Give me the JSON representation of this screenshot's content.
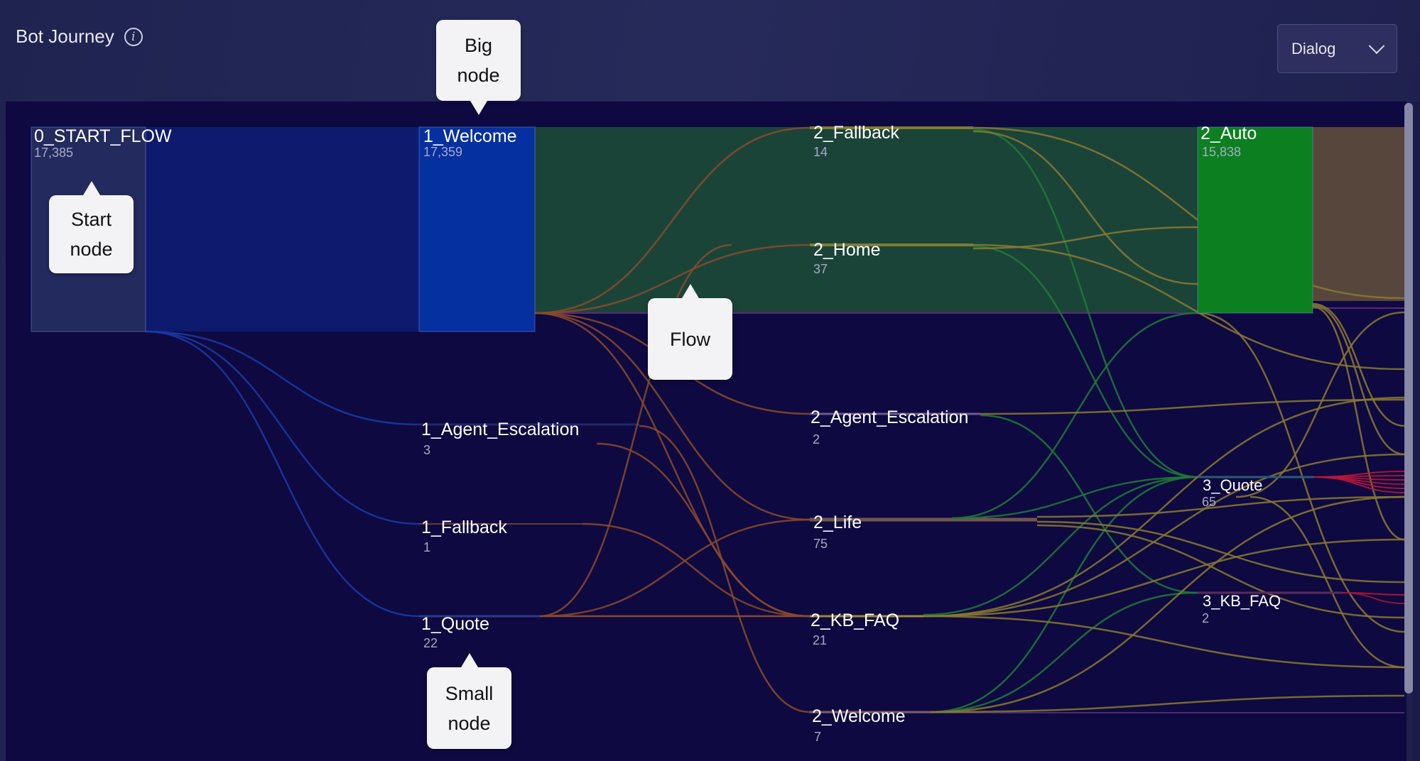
{
  "header": {
    "title": "Bot Journey",
    "info_icon": "info-circle-icon",
    "view_select": {
      "selected": "Dialog",
      "icon": "chevron-down-icon"
    }
  },
  "chart_data": {
    "type": "sankey",
    "title": "Bot Journey",
    "nodes": [
      {
        "id": "0_START_FLOW",
        "label": "0_START_FLOW",
        "count": "17,385",
        "value": 17385,
        "step": 0,
        "color": "#232a5e"
      },
      {
        "id": "1_Welcome",
        "label": "1_Welcome",
        "count": "17,359",
        "value": 17359,
        "step": 1,
        "color": "#0530a0"
      },
      {
        "id": "1_Agent_Escalation",
        "label": "1_Agent_Escalation",
        "count": "3",
        "value": 3,
        "step": 1,
        "color": "#1b2a80"
      },
      {
        "id": "1_Fallback",
        "label": "1_Fallback",
        "count": "1",
        "value": 1,
        "step": 1,
        "color": "#1b2a80"
      },
      {
        "id": "1_Quote",
        "label": "1_Quote",
        "count": "22",
        "value": 22,
        "step": 1,
        "color": "#1b2a80"
      },
      {
        "id": "2_Fallback",
        "label": "2_Fallback",
        "count": "14",
        "value": 14,
        "step": 2,
        "color": "#1b4b3a"
      },
      {
        "id": "2_Home",
        "label": "2_Home",
        "count": "37",
        "value": 37,
        "step": 2,
        "color": "#1b4b3a"
      },
      {
        "id": "2_Agent_Escalation",
        "label": "2_Agent_Escalation",
        "count": "2",
        "value": 2,
        "step": 2,
        "color": "#2a2f70"
      },
      {
        "id": "2_Life",
        "label": "2_Life",
        "count": "75",
        "value": 75,
        "step": 2,
        "color": "#2a2f70"
      },
      {
        "id": "2_KB_FAQ",
        "label": "2_KB_FAQ",
        "count": "21",
        "value": 21,
        "step": 2,
        "color": "#2a2f70"
      },
      {
        "id": "2_Welcome",
        "label": "2_Welcome",
        "count": "7",
        "value": 7,
        "step": 2,
        "color": "#2a2f70"
      },
      {
        "id": "2_Auto",
        "label": "2_Auto",
        "count": "15,838",
        "value": 15838,
        "step": 2,
        "color": "#0c8020"
      },
      {
        "id": "3_Quote",
        "label": "3_Quote",
        "count": "65",
        "value": 65,
        "step": 3,
        "color": "#2a4a6a"
      },
      {
        "id": "3_KB_FAQ",
        "label": "3_KB_FAQ",
        "count": "2",
        "value": 2,
        "step": 3,
        "color": "#2a4a6a"
      }
    ],
    "links": [
      {
        "source": "0_START_FLOW",
        "target": "1_Welcome",
        "color": "#0e1a6e"
      },
      {
        "source": "0_START_FLOW",
        "target": "1_Agent_Escalation",
        "color": "#1a3aa8"
      },
      {
        "source": "0_START_FLOW",
        "target": "1_Fallback",
        "color": "#1a3aa8"
      },
      {
        "source": "0_START_FLOW",
        "target": "1_Quote",
        "color": "#1a3aa8"
      },
      {
        "source": "1_Welcome",
        "target": "2_Auto",
        "color": "#1b4439"
      },
      {
        "source": "1_Welcome",
        "target": "2_Fallback",
        "color": "#8a4a2a"
      },
      {
        "source": "1_Welcome",
        "target": "2_Home",
        "color": "#8a4a2a"
      },
      {
        "source": "1_Welcome",
        "target": "2_Agent_Escalation",
        "color": "#8a4a2a"
      },
      {
        "source": "1_Welcome",
        "target": "2_Life",
        "color": "#8a4a2a"
      },
      {
        "source": "1_Welcome",
        "target": "2_KB_FAQ",
        "color": "#8a4a2a"
      },
      {
        "source": "1_Agent_Escalation",
        "target": "2_KB_FAQ",
        "color": "#8a4a2a"
      },
      {
        "source": "1_Agent_Escalation",
        "target": "2_Welcome",
        "color": "#8a4a2a"
      },
      {
        "source": "1_Fallback",
        "target": "2_KB_FAQ",
        "color": "#8a4a2a"
      },
      {
        "source": "1_Quote",
        "target": "2_Home",
        "color": "#8a4a2a"
      },
      {
        "source": "1_Quote",
        "target": "2_Life",
        "color": "#8a4a2a"
      },
      {
        "source": "1_Quote",
        "target": "2_KB_FAQ",
        "color": "#8a4a2a"
      },
      {
        "source": "2_Fallback",
        "target": "3_Quote",
        "color": "#1f7a3a"
      },
      {
        "source": "2_Home",
        "target": "3_Quote",
        "color": "#1f7a3a"
      },
      {
        "source": "2_Agent_Escalation",
        "target": "3_KB_FAQ",
        "color": "#1f7a3a"
      },
      {
        "source": "2_Life",
        "target": "3_Quote",
        "color": "#1f7a3a"
      },
      {
        "source": "2_KB_FAQ",
        "target": "3_Quote",
        "color": "#1f7a3a"
      },
      {
        "source": "2_Welcome",
        "target": "3_Quote",
        "color": "#1f7a3a"
      },
      {
        "source": "2_Welcome",
        "target": "3_KB_FAQ",
        "color": "#1f7a3a"
      },
      {
        "source": "2_Auto",
        "target": "3_Quote",
        "color": "#1f7a3a"
      }
    ]
  },
  "callouts": [
    {
      "id": "start-node",
      "text_line1": "Start",
      "text_line2": "node"
    },
    {
      "id": "big-node",
      "text_line1": "Big",
      "text_line2": "node"
    },
    {
      "id": "flow",
      "text_line1": "Flow",
      "text_line2": ""
    },
    {
      "id": "small-node",
      "text_line1": "Small",
      "text_line2": "node"
    }
  ]
}
